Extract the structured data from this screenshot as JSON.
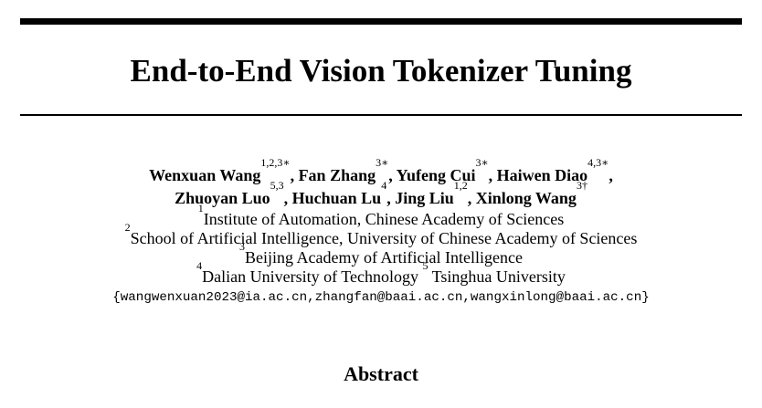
{
  "paper": {
    "title": "End-to-End Vision Tokenizer Tuning",
    "authors_line1": [
      {
        "name": "Wenxuan Wang",
        "sup": "1,2,3∗",
        "sep": ", "
      },
      {
        "name": "Fan Zhang",
        "sup": "3∗",
        "sep": ", "
      },
      {
        "name": "Yufeng Cui",
        "sup": "3∗",
        "sep": ", "
      },
      {
        "name": "Haiwen Diao",
        "sup": "4,3∗",
        "sep": ","
      }
    ],
    "authors_line2": [
      {
        "name": "Zhuoyan Luo",
        "sup": "5,3",
        "sep": ", "
      },
      {
        "name": "Huchuan Lu",
        "sup": "4",
        "sep": ", "
      },
      {
        "name": "Jing Liu",
        "sup": "1,2",
        "sep": ", "
      },
      {
        "name": "Xinlong Wang",
        "sup": "3†",
        "sep": ""
      }
    ],
    "affiliations": [
      {
        "sup": "1",
        "text": "Institute of Automation, Chinese Academy of Sciences"
      },
      {
        "sup": "2",
        "text": "School of Artificial Intelligence, University of Chinese Academy of Sciences"
      },
      {
        "sup": "3",
        "text": "Beijing Academy of Artificial Intelligence"
      }
    ],
    "affiliation_line4": {
      "sup_a": "4",
      "text_a": "Dalian University of Technology ",
      "sup_b": "5",
      "text_b": " Tsinghua University"
    },
    "emails": "{wangwenxuan2023@ia.ac.cn,zhangfan@baai.ac.cn,wangxinlong@baai.ac.cn}",
    "abstract_heading": "Abstract"
  }
}
